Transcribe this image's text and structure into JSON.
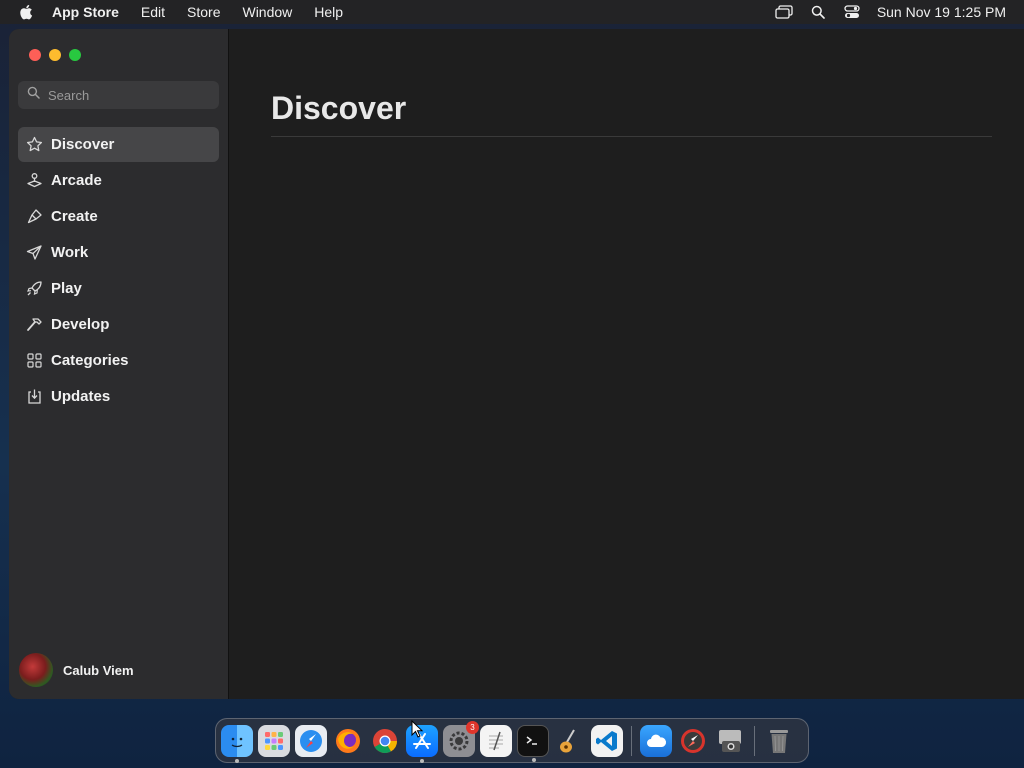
{
  "menubar": {
    "app_name": "App Store",
    "items": [
      "Edit",
      "Store",
      "Window",
      "Help"
    ],
    "clock": "Sun Nov 19  1:25 PM",
    "icons": [
      "apple-icon",
      "screen-mirror-icon",
      "spotlight-search-icon",
      "control-center-icon"
    ]
  },
  "window": {
    "traffic_lights": {
      "close": "#fe5f57",
      "minimize": "#febc2e",
      "maximize": "#28c840"
    }
  },
  "sidebar": {
    "search_placeholder": "Search",
    "items": [
      {
        "label": "Discover",
        "icon": "star-icon",
        "active": true
      },
      {
        "label": "Arcade",
        "icon": "joystick-icon",
        "active": false
      },
      {
        "label": "Create",
        "icon": "brush-icon",
        "active": false
      },
      {
        "label": "Work",
        "icon": "paper-plane-icon",
        "active": false
      },
      {
        "label": "Play",
        "icon": "rocket-icon",
        "active": false
      },
      {
        "label": "Develop",
        "icon": "hammer-icon",
        "active": false
      },
      {
        "label": "Categories",
        "icon": "grid-icon",
        "active": false
      },
      {
        "label": "Updates",
        "icon": "download-icon",
        "active": false
      }
    ],
    "account_name": "Calub Viem"
  },
  "main": {
    "title": "Discover"
  },
  "dock": {
    "apps": [
      {
        "name": "Finder",
        "icon": "finder-icon",
        "running": true
      },
      {
        "name": "Launchpad",
        "icon": "launchpad-icon",
        "running": false
      },
      {
        "name": "Safari",
        "icon": "safari-icon",
        "running": false
      },
      {
        "name": "Firefox",
        "icon": "firefox-icon",
        "running": false
      },
      {
        "name": "Chrome",
        "icon": "chrome-icon",
        "running": false
      },
      {
        "name": "App Store",
        "icon": "app-store-icon",
        "running": true
      },
      {
        "name": "System Settings",
        "icon": "settings-icon",
        "running": false,
        "badge": "3"
      },
      {
        "name": "TextEdit",
        "icon": "textedit-icon",
        "running": false
      },
      {
        "name": "Terminal",
        "icon": "terminal-icon",
        "running": true
      },
      {
        "name": "GarageBand",
        "icon": "garageband-icon",
        "running": false
      },
      {
        "name": "VS Code",
        "icon": "vscode-icon",
        "running": false
      },
      {
        "name": "Weather",
        "icon": "weather-icon",
        "running": false
      },
      {
        "name": "Compass",
        "icon": "compass-icon",
        "running": false
      },
      {
        "name": "Screenshot",
        "icon": "screenshot-icon",
        "running": false
      },
      {
        "name": "Trash",
        "icon": "trash-icon",
        "running": false
      }
    ]
  }
}
